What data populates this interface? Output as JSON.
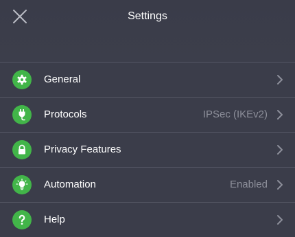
{
  "header": {
    "title": "Settings",
    "close_icon": "close-icon"
  },
  "accent_color": "#42b549",
  "menu": {
    "items": [
      {
        "label": "General",
        "value": "",
        "icon": "gear-icon"
      },
      {
        "label": "Protocols",
        "value": "IPSec (IKEv2)",
        "icon": "plug-icon"
      },
      {
        "label": "Privacy Features",
        "value": "",
        "icon": "lock-icon"
      },
      {
        "label": "Automation",
        "value": "Enabled",
        "icon": "lightbulb-icon"
      },
      {
        "label": "Help",
        "value": "",
        "icon": "question-icon"
      }
    ]
  }
}
